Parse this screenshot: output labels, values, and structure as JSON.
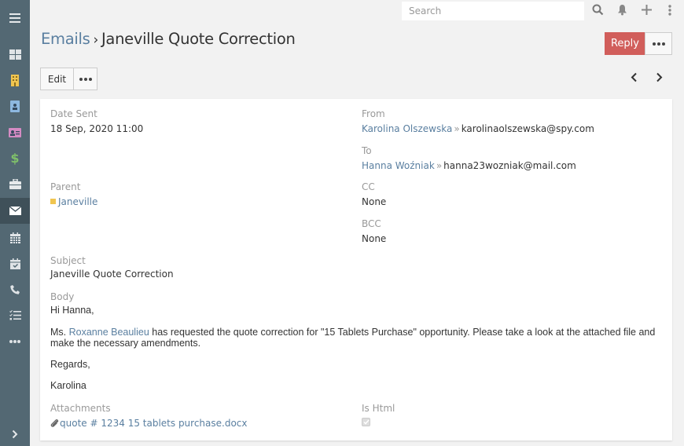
{
  "sidebar": {
    "items": [
      {
        "name": "menu",
        "icon": "hamburger-icon"
      },
      {
        "name": "dashboard",
        "icon": "dashboard-grid-icon"
      },
      {
        "name": "accounts",
        "icon": "building-icon"
      },
      {
        "name": "contacts",
        "icon": "contact-badge-icon"
      },
      {
        "name": "leads",
        "icon": "id-card-icon"
      },
      {
        "name": "opportunities",
        "icon": "dollar-icon"
      },
      {
        "name": "cases",
        "icon": "briefcase-icon"
      },
      {
        "name": "emails",
        "icon": "envelope-icon",
        "active": true
      },
      {
        "name": "calendar",
        "icon": "calendar-icon"
      },
      {
        "name": "meetings",
        "icon": "calendar-check-icon"
      },
      {
        "name": "calls",
        "icon": "phone-icon"
      },
      {
        "name": "tasks",
        "icon": "task-list-icon"
      },
      {
        "name": "more",
        "icon": "more-icon"
      },
      {
        "name": "expand",
        "icon": "chevron-right-icon"
      }
    ],
    "colors": {
      "background": "#536873",
      "active": "#3f5059"
    }
  },
  "topbar": {
    "search_placeholder": "Search",
    "search_value": "",
    "icons": [
      "search-icon",
      "bell-icon",
      "plus-icon",
      "kebab-menu-icon"
    ]
  },
  "header": {
    "breadcrumb_parent": "Emails",
    "breadcrumb_separator": "›",
    "title": "Janeville Quote Correction",
    "reply_label": "Reply",
    "edit_label": "Edit",
    "accent_color": "#d15e5b"
  },
  "record": {
    "date_sent": {
      "label": "Date Sent",
      "value": "18 Sep, 2020 11:00"
    },
    "from": {
      "label": "From",
      "name": "Karolina Olszewska",
      "separator": "»",
      "email": "karolinaolszewska@spy.com"
    },
    "to": {
      "label": "To",
      "name": "Hanna Woźniak",
      "separator": "»",
      "email": "hanna23wozniak@mail.com"
    },
    "parent": {
      "label": "Parent",
      "value": "Janeville"
    },
    "cc": {
      "label": "CC",
      "value": "None"
    },
    "bcc": {
      "label": "BCC",
      "value": "None"
    },
    "subject": {
      "label": "Subject",
      "value": "Janeville Quote Correction"
    },
    "body": {
      "label": "Body",
      "greeting": "Hi Hanna,",
      "line_prefix": "Ms. ",
      "line_link": "Roxanne Beaulieu",
      "line_rest_1": " has requested the quote correction for \"15 Tablets Purchase\" opportunity. Please take a look at the attached file and",
      "line_rest_2": "make the necessary amendments.",
      "closing": "Regards,",
      "signature": "Karolina"
    },
    "attachments": {
      "label": "Attachments",
      "file": "quote # 1234 15 tablets purchase.docx"
    },
    "is_html": {
      "label": "Is Html",
      "checked": true
    }
  }
}
